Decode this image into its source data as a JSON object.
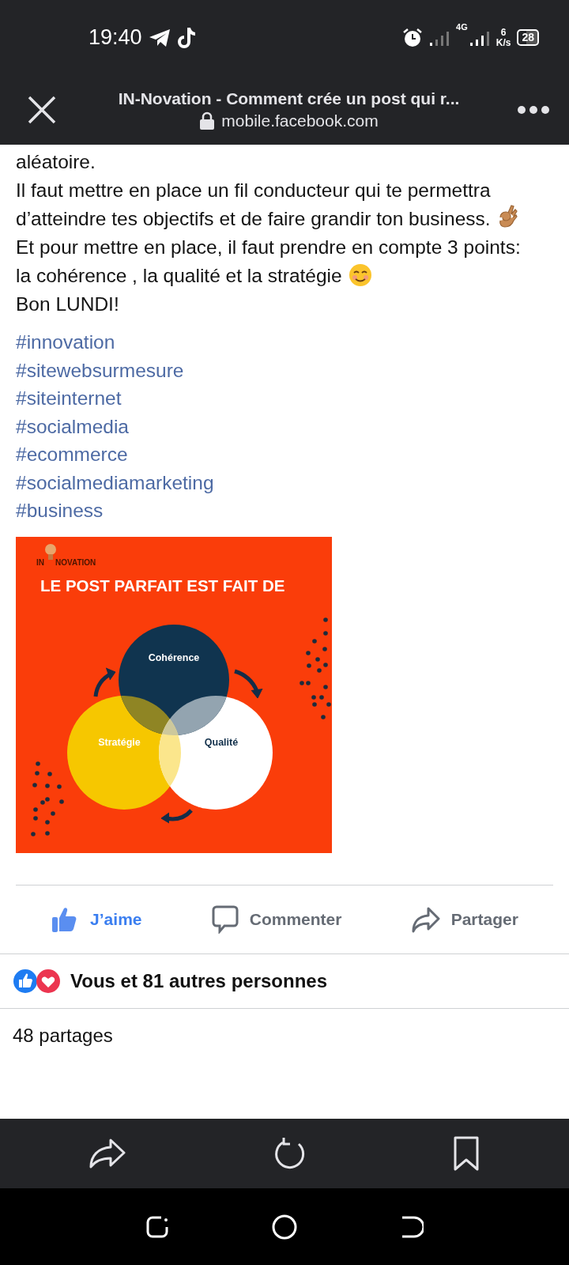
{
  "status_bar": {
    "time": "19:40",
    "network": "4G",
    "speed_value": "6",
    "speed_unit": "K/s",
    "battery": "28"
  },
  "browser_header": {
    "title": "IN-Novation - Comment crée un post qui r...",
    "url": "mobile.facebook.com"
  },
  "post": {
    "paragraphs": [
      {
        "text": "aléatoire."
      },
      {
        "text": "Il faut mettre en place un fil conducteur qui te permettra d’atteindre tes objectifs et de faire grandir ton business.",
        "kind": "ok_hand"
      },
      {
        "text": "Et pour mettre en place, il faut prendre en compte 3 points: la cohérence , la qualité et la stratégie",
        "kind": "smiling_face"
      },
      {
        "text": "Bon LUNDI!"
      }
    ],
    "hashtags": [
      "#innovation",
      "#sitewebsurmesure",
      "#siteinternet",
      "#socialmedia",
      "#ecommerce",
      "#socialmediamarketing",
      "#business"
    ],
    "image": {
      "logo": [
        "IN",
        "NOVATION"
      ],
      "headline": "LE POST PARFAIT EST FAIT DE",
      "circles": [
        {
          "label": "Cohérence",
          "color": "#10344f"
        },
        {
          "label": "Stratégie",
          "color": "#f6c700"
        },
        {
          "label": "Qualité",
          "color": "#ffffff"
        }
      ]
    },
    "actions": [
      {
        "kind": "like",
        "label": "J’aime",
        "selected": true
      },
      {
        "kind": "comment",
        "label": "Commenter",
        "selected": false
      },
      {
        "kind": "share",
        "label": "Partager",
        "selected": false
      }
    ],
    "reactions": {
      "icons": [
        {
          "kind": "like"
        },
        {
          "kind": "love"
        }
      ],
      "text": "Vous et 81 autres personnes"
    },
    "shares": "48 partages"
  }
}
